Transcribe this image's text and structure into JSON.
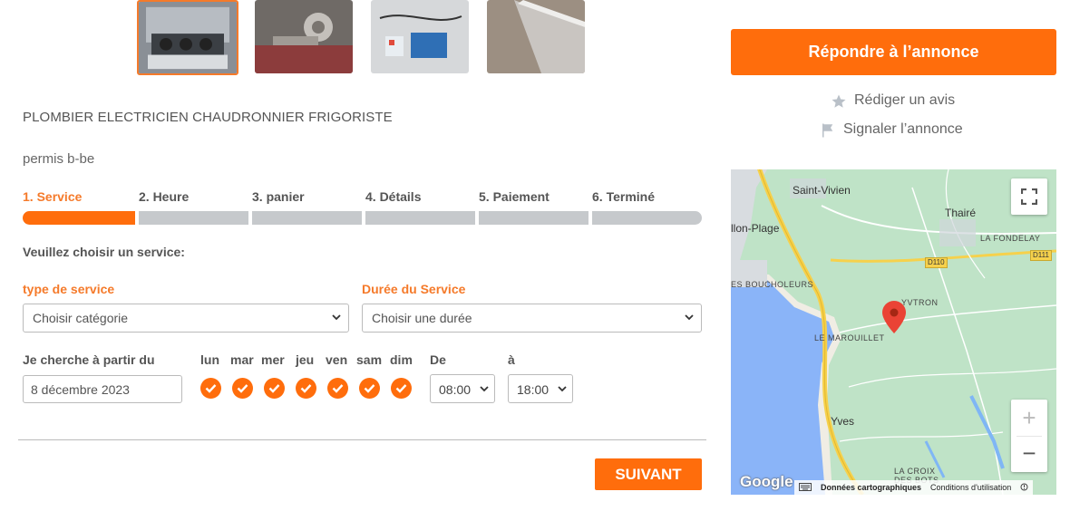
{
  "thumbnails": [
    {
      "name": "photo-1",
      "selected": true
    },
    {
      "name": "photo-2",
      "selected": false
    },
    {
      "name": "photo-3",
      "selected": false
    },
    {
      "name": "photo-4",
      "selected": false
    }
  ],
  "listing": {
    "title": "PLOMBIER ELECTRICIEN CHAUDRONNIER FRIGORISTE",
    "subtitle": "permis b-be"
  },
  "steps": [
    {
      "label": "1. Service",
      "active": true
    },
    {
      "label": "2. Heure",
      "active": false
    },
    {
      "label": "3. panier",
      "active": false
    },
    {
      "label": "4. Détails",
      "active": false
    },
    {
      "label": "5. Paiement",
      "active": false
    },
    {
      "label": "6. Terminé",
      "active": false
    }
  ],
  "form": {
    "prompt": "Veuillez choisir un service:",
    "service_type_label": "type de service",
    "service_type_value": "Choisir catégorie",
    "duration_label": "Durée du Service",
    "duration_value": "Choisir une durée",
    "search_from_label": "Je cherche à partir du",
    "date_value": "8 décembre 2023",
    "days": [
      "lun",
      "mar",
      "mer",
      "jeu",
      "ven",
      "sam",
      "dim"
    ],
    "from_label": "De",
    "from_value": "08:00",
    "to_label": "à",
    "to_value": "18:00",
    "next_label": "SUIVANT"
  },
  "sidebar": {
    "reply_label": "Répondre à l’annonce",
    "review_label": "Rédiger un avis",
    "report_label": "Signaler l’annonce"
  },
  "map": {
    "places": {
      "saint_vivien": "Saint-Vivien",
      "thaire": "Thairé",
      "llon_plage": "llon-Plage",
      "la_fondelay": "LA FONDELAY",
      "d110": "D110",
      "d111": "D111",
      "es_boucholeurs": "ES BOUCHOLEURS",
      "yvtron": "YVTRON",
      "le_marouillet": "LE MAROUILLET",
      "yves": "Yves",
      "la_croix": "LA CROIX",
      "des_bots": "DES BOTS"
    },
    "logo": "Google",
    "footer_data": "Données cartographiques",
    "footer_terms": "Conditions d'utilisation",
    "zoom_in": "+",
    "zoom_out": "−"
  },
  "colors": {
    "accent": "#ff6d0c",
    "inactive_bar": "#c6c9cc",
    "map_land": "#bfe3c7",
    "map_water": "#8ab4f8"
  }
}
